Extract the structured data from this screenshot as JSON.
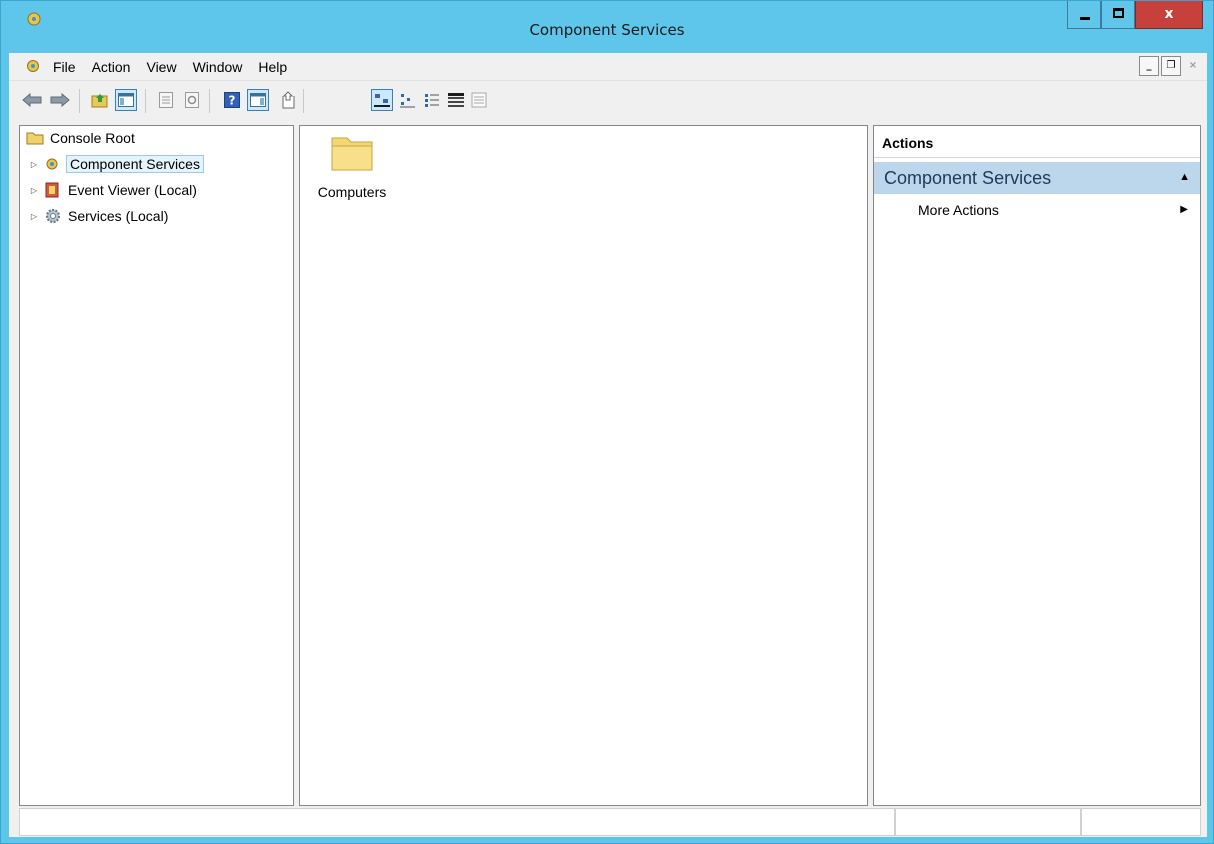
{
  "window": {
    "title": "Component Services",
    "close_glyph": "x"
  },
  "menu": {
    "items": [
      "File",
      "Action",
      "View",
      "Window",
      "Help"
    ]
  },
  "mdi": {
    "minimize": "_",
    "restore": "❐",
    "close": "×"
  },
  "tree": {
    "root": "Console Root",
    "items": [
      {
        "label": "Component Services",
        "icon": "component-services-icon",
        "selected": true
      },
      {
        "label": "Event Viewer (Local)",
        "icon": "event-viewer-icon",
        "selected": false
      },
      {
        "label": "Services (Local)",
        "icon": "services-gear-icon",
        "selected": false
      }
    ]
  },
  "center": {
    "items": [
      {
        "label": "Computers",
        "icon": "folder-icon"
      }
    ]
  },
  "actions": {
    "header": "Actions",
    "section": "Component Services",
    "items": [
      {
        "label": "More Actions"
      }
    ]
  },
  "colors": {
    "title_bar": "#5ec6ea",
    "close_button": "#c7403c",
    "selection": "#e5f3fb",
    "actions_section": "#bcd7ec"
  }
}
